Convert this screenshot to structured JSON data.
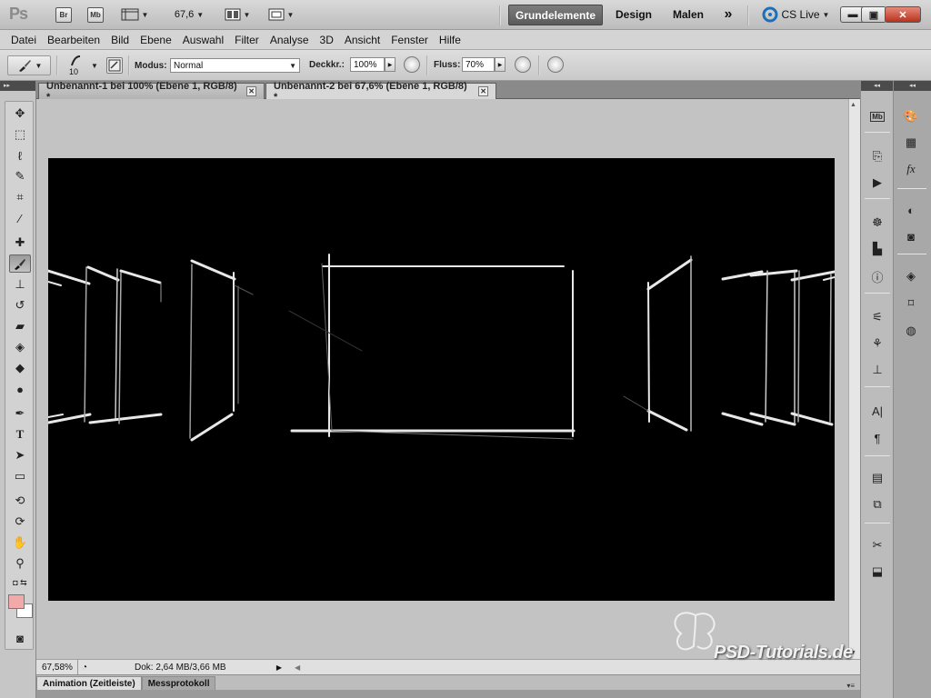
{
  "app": {
    "logo": "Ps",
    "bridge_label": "Br",
    "minibridge_label": "Mb",
    "zoom_value": "67,6",
    "workspaces": {
      "active": "Grundelemente",
      "item2": "Design",
      "item3": "Malen",
      "more": "»"
    },
    "cs_live": "CS Live"
  },
  "menu": [
    "Datei",
    "Bearbeiten",
    "Bild",
    "Ebene",
    "Auswahl",
    "Filter",
    "Analyse",
    "3D",
    "Ansicht",
    "Fenster",
    "Hilfe"
  ],
  "options": {
    "brush_size": "10",
    "mode_label": "Modus:",
    "mode_value": "Normal",
    "opacity_label": "Deckkr.:",
    "opacity_value": "100%",
    "flow_label": "Fluss:",
    "flow_value": "70%"
  },
  "tabs": [
    {
      "label": "Unbenannt-1 bei 100% (Ebene 1, RGB/8) *",
      "active": false
    },
    {
      "label": "Unbenannt-2 bei 67,6% (Ebene 1, RGB/8) *",
      "active": true
    }
  ],
  "status": {
    "zoom": "67,58%",
    "doc": "Dok: 2,64 MB/3,66 MB"
  },
  "bottom_tabs": [
    "Animation (Zeitleiste)",
    "Messprotokoll"
  ],
  "watermark": "PSD-Tutorials.de",
  "colors": {
    "foreground": "#f2a9a9",
    "background": "#ffffff",
    "canvas": "#000000"
  }
}
